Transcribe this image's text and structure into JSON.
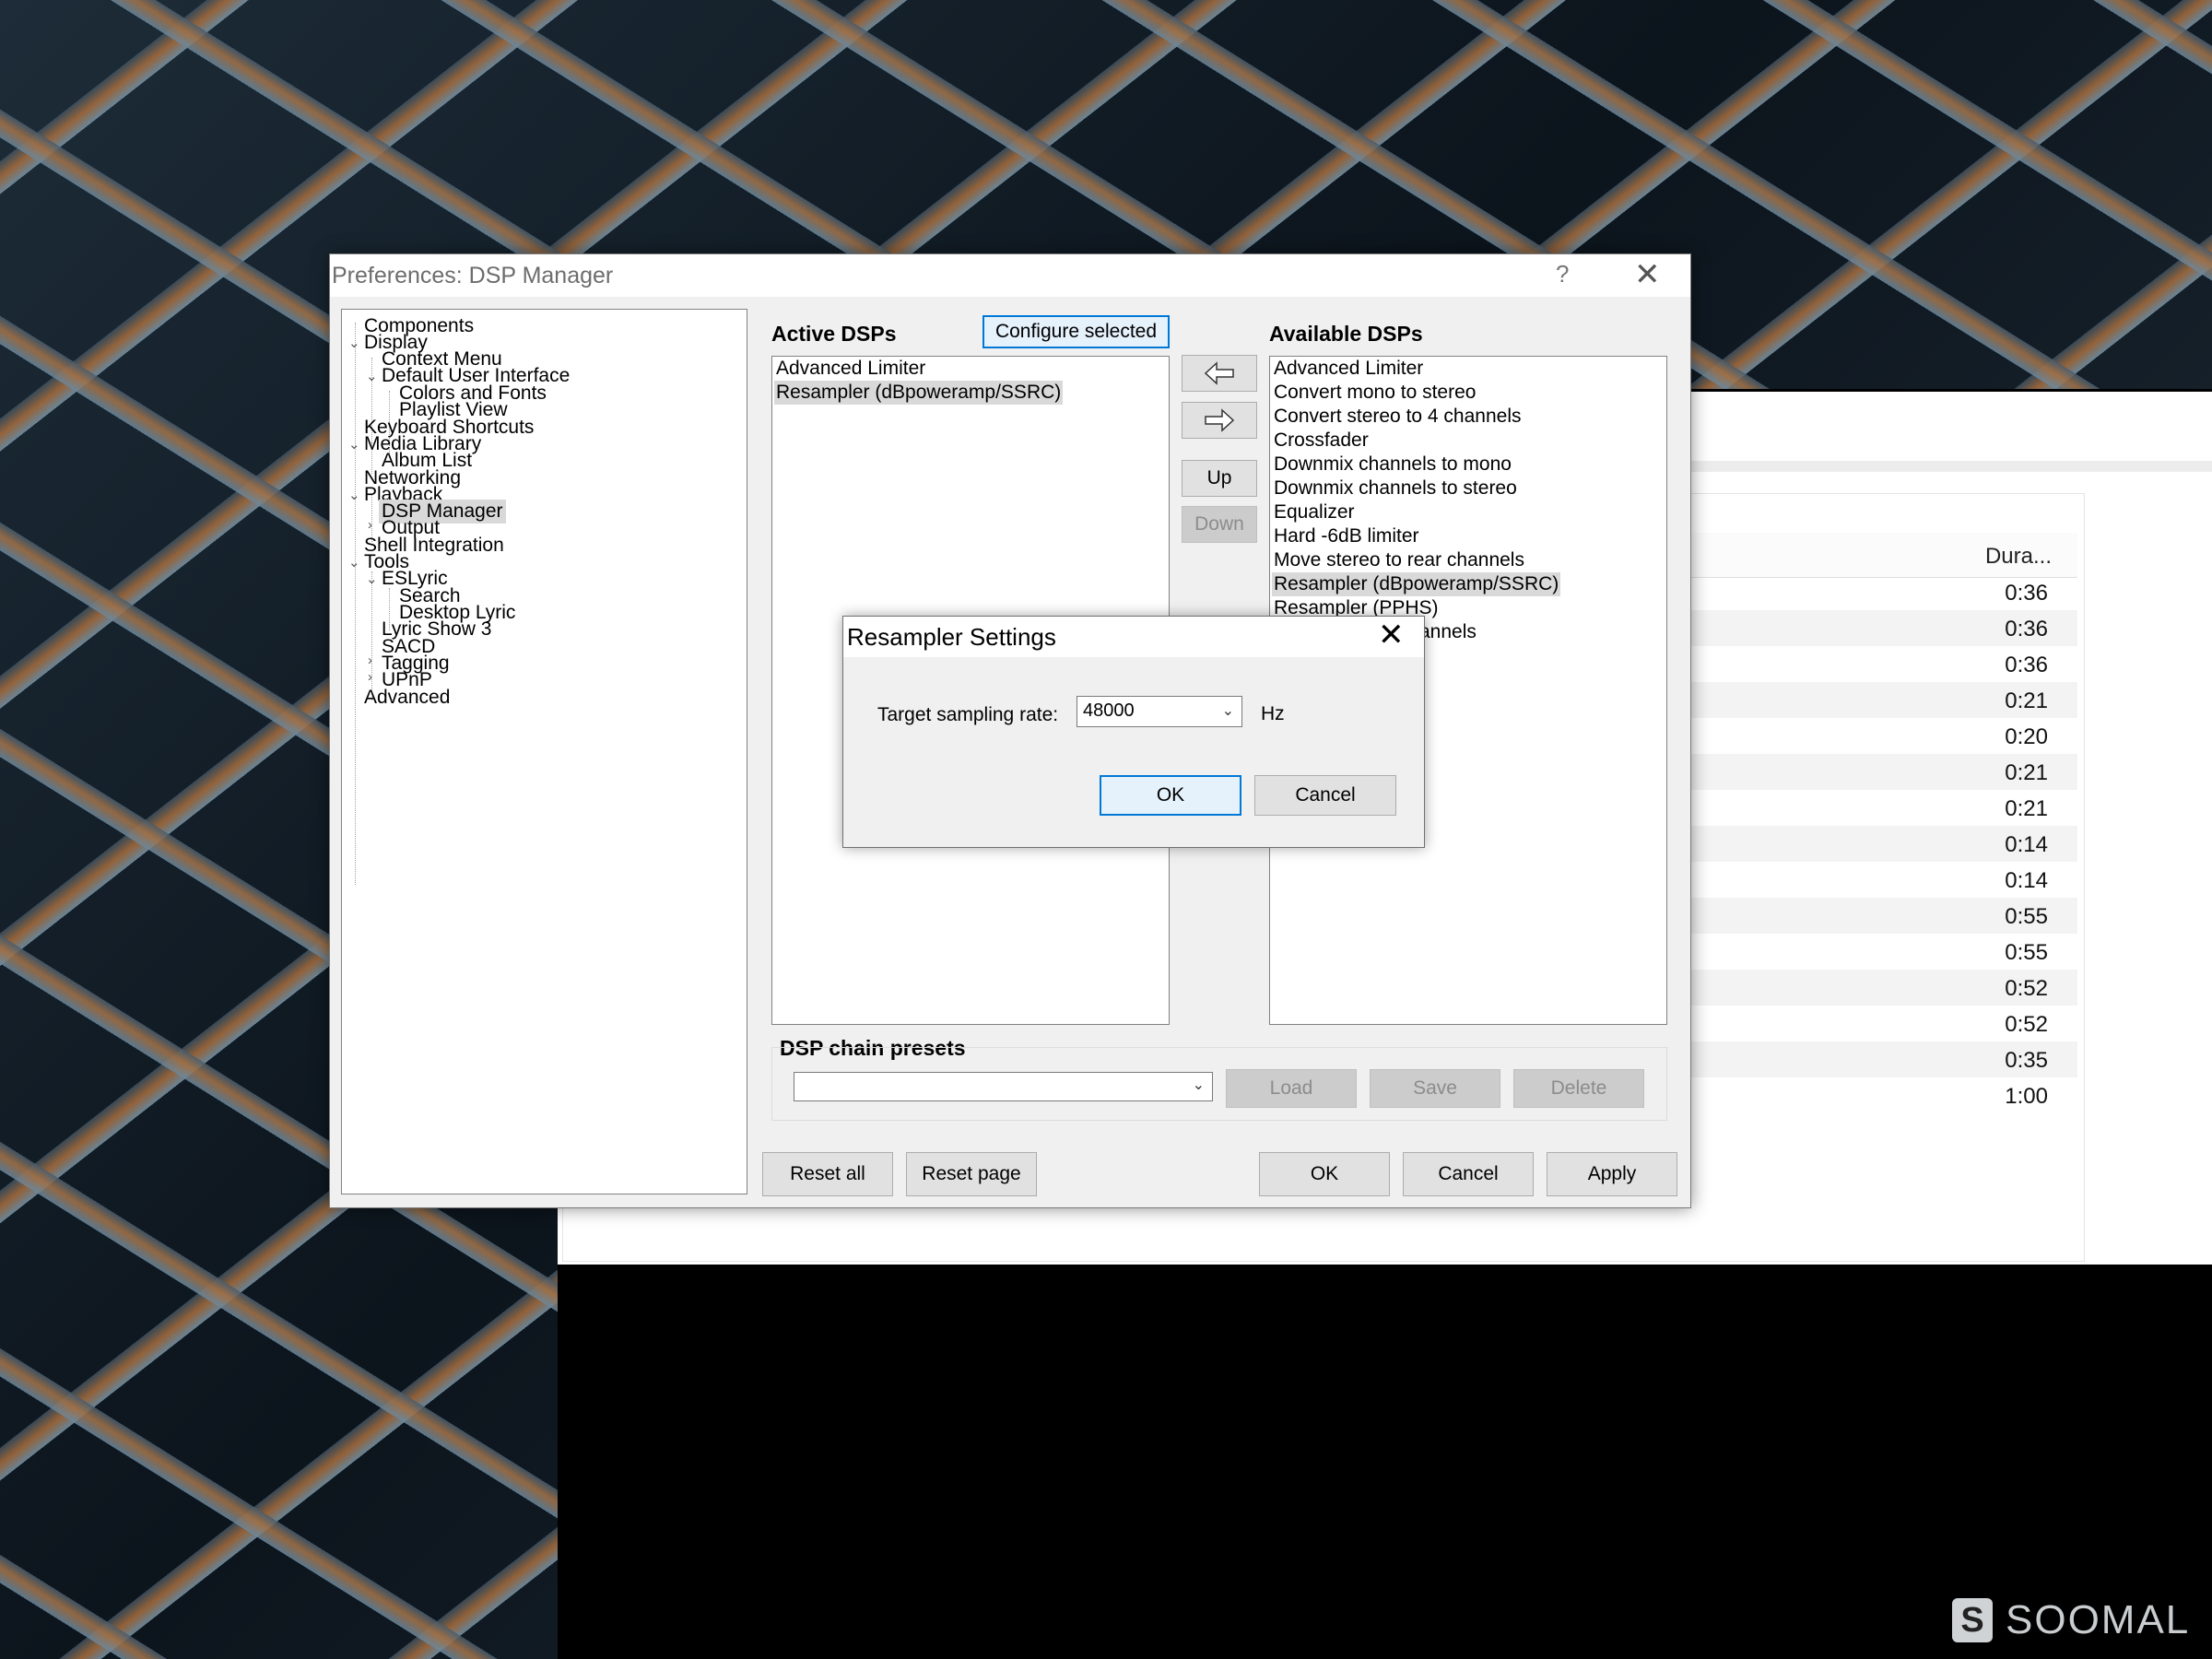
{
  "prefs": {
    "title": "Preferences: DSP Manager",
    "help_glyph": "?",
    "close_glyph": "✕"
  },
  "tree": {
    "items": [
      {
        "label": "Components"
      },
      {
        "label": "Display"
      },
      {
        "label": "Context Menu"
      },
      {
        "label": "Default User Interface"
      },
      {
        "label": "Colors and Fonts"
      },
      {
        "label": "Playlist View"
      },
      {
        "label": "Keyboard Shortcuts"
      },
      {
        "label": "Media Library"
      },
      {
        "label": "Album List"
      },
      {
        "label": "Networking"
      },
      {
        "label": "Playback"
      },
      {
        "label": "DSP Manager"
      },
      {
        "label": "Output"
      },
      {
        "label": "Shell Integration"
      },
      {
        "label": "Tools"
      },
      {
        "label": "ESLyric"
      },
      {
        "label": "Search"
      },
      {
        "label": "Desktop Lyric"
      },
      {
        "label": "Lyric Show 3"
      },
      {
        "label": "SACD"
      },
      {
        "label": "Tagging"
      },
      {
        "label": "UPnP"
      },
      {
        "label": "Advanced"
      }
    ]
  },
  "active_dsps": {
    "title": "Active DSPs",
    "configure_label": "Configure selected",
    "items": [
      "Advanced Limiter",
      "Resampler (dBpoweramp/SSRC)"
    ]
  },
  "available_dsps": {
    "title": "Available DSPs",
    "items": [
      "Advanced Limiter",
      "Convert mono to stereo",
      "Convert stereo to 4 channels",
      "Crossfader",
      "Downmix channels to mono",
      "Downmix channels to stereo",
      "Equalizer",
      "Hard -6dB limiter",
      "Move stereo to rear channels",
      "Resampler (dBpoweramp/SSRC)",
      "Resampler (PPHS)",
      "annels"
    ]
  },
  "mover": {
    "up_label": "Up",
    "down_label": "Down"
  },
  "presets": {
    "title": "DSP chain presets",
    "load_label": "Load",
    "save_label": "Save",
    "delete_label": "Delete"
  },
  "footer": {
    "reset_all": "Reset all",
    "reset_page": "Reset page",
    "ok": "OK",
    "cancel": "Cancel",
    "apply": "Apply"
  },
  "resampler": {
    "title": "Resampler Settings",
    "close_glyph": "✕",
    "rate_label": "Target sampling rate:",
    "rate_value": "48000",
    "unit": "Hz",
    "ok": "OK",
    "cancel": "Cancel"
  },
  "background_playlist": {
    "column_header": "Dura...",
    "durations": [
      "0:36",
      "0:36",
      "0:36",
      "0:21",
      "0:20",
      "0:21",
      "0:21",
      "0:14",
      "0:14",
      "0:55",
      "0:55",
      "0:52",
      "0:52",
      "0:35",
      "1:00"
    ]
  },
  "watermark": {
    "text": "SOOMAL"
  }
}
